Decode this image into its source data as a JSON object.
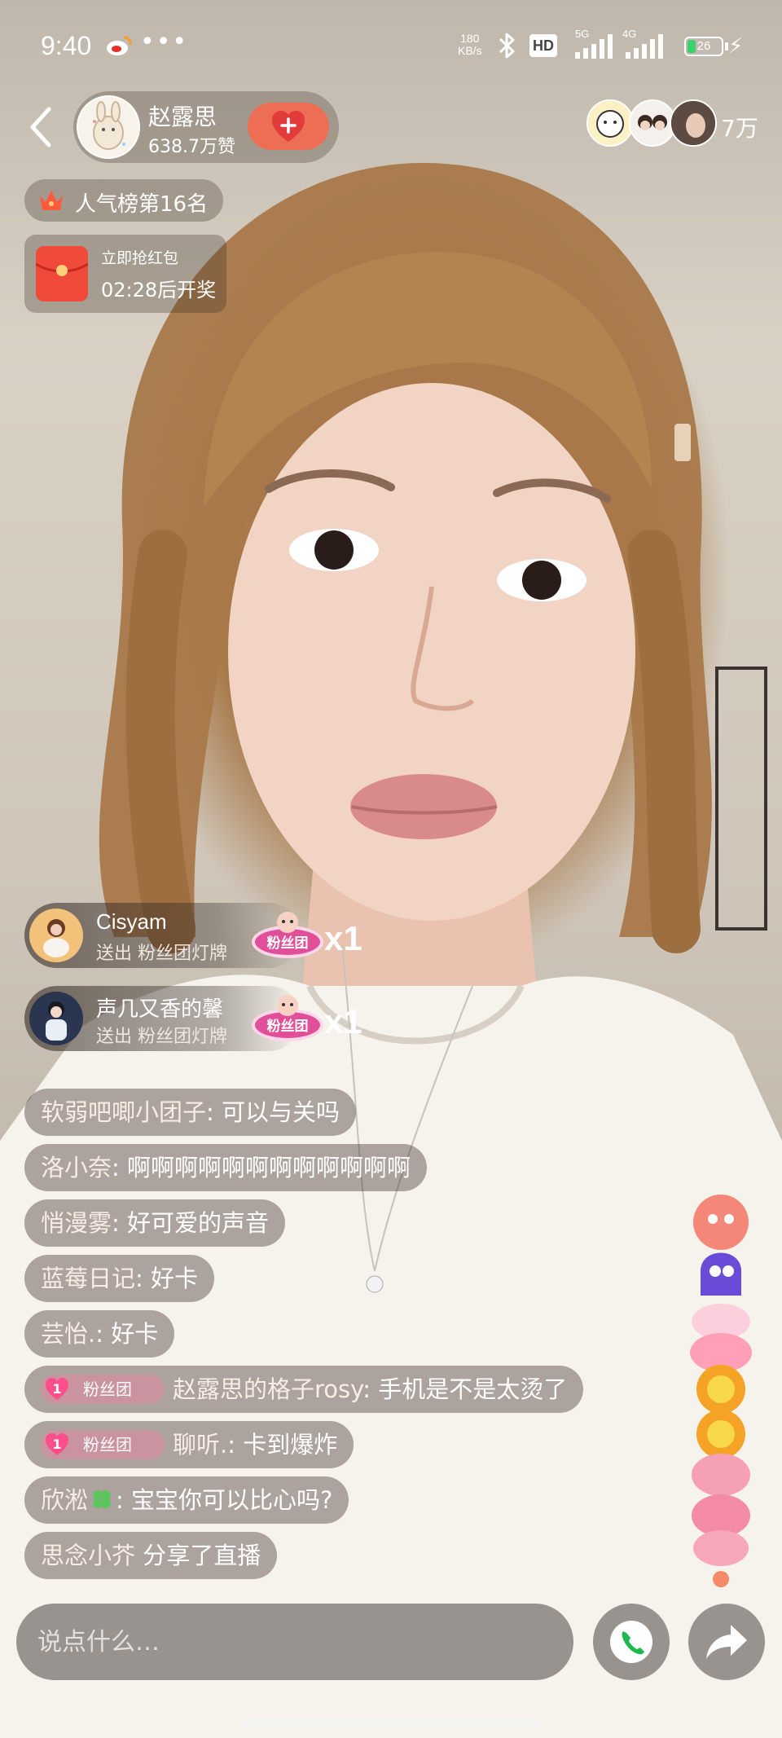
{
  "status_bar": {
    "time": "9:40",
    "more": "•••",
    "net_speed_value": "180",
    "net_speed_unit": "KB/s",
    "hd": "HD",
    "net1": "5G",
    "net2": "4G",
    "battery": "26",
    "battery_level": 0.26
  },
  "host": {
    "name": "赵露思",
    "likes": "638.7万赞"
  },
  "viewers": {
    "count": "7万"
  },
  "rank": {
    "text": "人气榜第16名"
  },
  "red_packet": {
    "title": "立即抢红包",
    "timer": "02:28后开奖"
  },
  "gifts": [
    {
      "user": "Cisyam",
      "desc": "送出 粉丝团灯牌",
      "badge": "粉丝团",
      "count": "x1"
    },
    {
      "user": "声几又香的馨",
      "desc": "送出 粉丝团灯牌",
      "badge": "粉丝团",
      "count": "x1"
    }
  ],
  "comments": [
    {
      "user": "软弱吧唧小团子",
      "text": ": 可以与关吗"
    },
    {
      "user": "洛小奈",
      "text": ": 啊啊啊啊啊啊啊啊啊啊啊啊"
    },
    {
      "user": "悄漫雾",
      "text": ": 好可爱的声音"
    },
    {
      "user": "蓝莓日记",
      "text": ": 好卡"
    },
    {
      "user": "芸怡.",
      "text": ": 好卡"
    },
    {
      "fan_level": "1",
      "fan_label": "粉丝团",
      "user": "赵露思的格子rosy",
      "text": ": 手机是不是太烫了"
    },
    {
      "fan_level": "1",
      "fan_label": "粉丝团",
      "user": "聊听.",
      "text": ": 卡到爆炸"
    },
    {
      "user": "欣淞",
      "text": ": 宝宝你可以比心吗?"
    },
    {
      "user": "思念小芥",
      "text": " 分享了直播"
    }
  ],
  "input": {
    "placeholder": "说点什么…"
  },
  "colors": {
    "follow": "#ee6d55",
    "packet": "#f04a3a",
    "battery": "#3bd16f"
  },
  "icons": [
    "back-arrow-icon",
    "heart-plus-icon",
    "crown-icon",
    "red-packet-icon",
    "phone-icon",
    "share-arrow-icon",
    "bluetooth-icon",
    "weibo-icon"
  ]
}
